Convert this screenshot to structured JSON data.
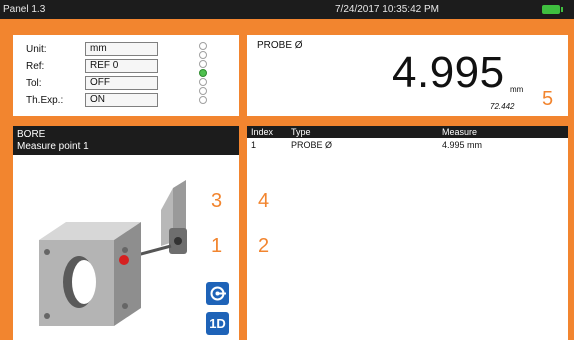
{
  "titlebar": {
    "title": "Panel 1.3",
    "datetime": "7/24/2017 10:35:42 PM",
    "battery_icon": "battery-icon"
  },
  "settings": {
    "rows": [
      {
        "label": "Unit:",
        "value": "mm"
      },
      {
        "label": "Ref:",
        "value": "REF 0"
      },
      {
        "label": "Tol:",
        "value": "OFF"
      },
      {
        "label": "Th.Exp.:",
        "value": "ON"
      }
    ],
    "leds_active_index": 3
  },
  "reading": {
    "label": "PROBE Ø",
    "value": "4.995",
    "unit": "mm",
    "sub_value": "72.442"
  },
  "bore": {
    "title": "BORE",
    "subtitle": "Measure point 1"
  },
  "list": {
    "headers": [
      "Index",
      "Type",
      "Measure"
    ],
    "rows": [
      {
        "index": "1",
        "type": "PROBE Ø",
        "measure": "4.995 mm"
      }
    ]
  },
  "markers": {
    "m1": "1",
    "m2": "2",
    "m3": "3",
    "m4": "4",
    "m5": "5"
  },
  "buttons": {
    "probe_mode_icon": "probe-icon",
    "dimension_label": "1D"
  },
  "colors": {
    "accent": "#f2852f",
    "header": "#1c1c1c",
    "button": "#1e63b8",
    "led_on": "#4fc04f"
  }
}
